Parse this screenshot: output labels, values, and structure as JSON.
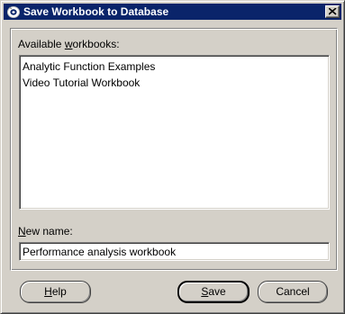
{
  "window": {
    "title": "Save Workbook to Database"
  },
  "workbooks": {
    "label_pre": "Available ",
    "label_mnemonic": "w",
    "label_post": "orkbooks:",
    "items": [
      "Analytic Function Examples",
      "Video Tutorial Workbook"
    ]
  },
  "new_name": {
    "label_mnemonic": "N",
    "label_post": "ew name:",
    "value": "Performance analysis workbook"
  },
  "buttons": {
    "help_mnemonic": "H",
    "help_rest": "elp",
    "save_mnemonic": "S",
    "save_rest": "ave",
    "cancel": "Cancel"
  },
  "colors": {
    "titlebar": "#0a246a",
    "dialog_bg": "#d4d0c8",
    "title_text": "#ffffff"
  },
  "icons": {
    "title": "oracle-discoverer-icon",
    "close": "close-icon"
  }
}
